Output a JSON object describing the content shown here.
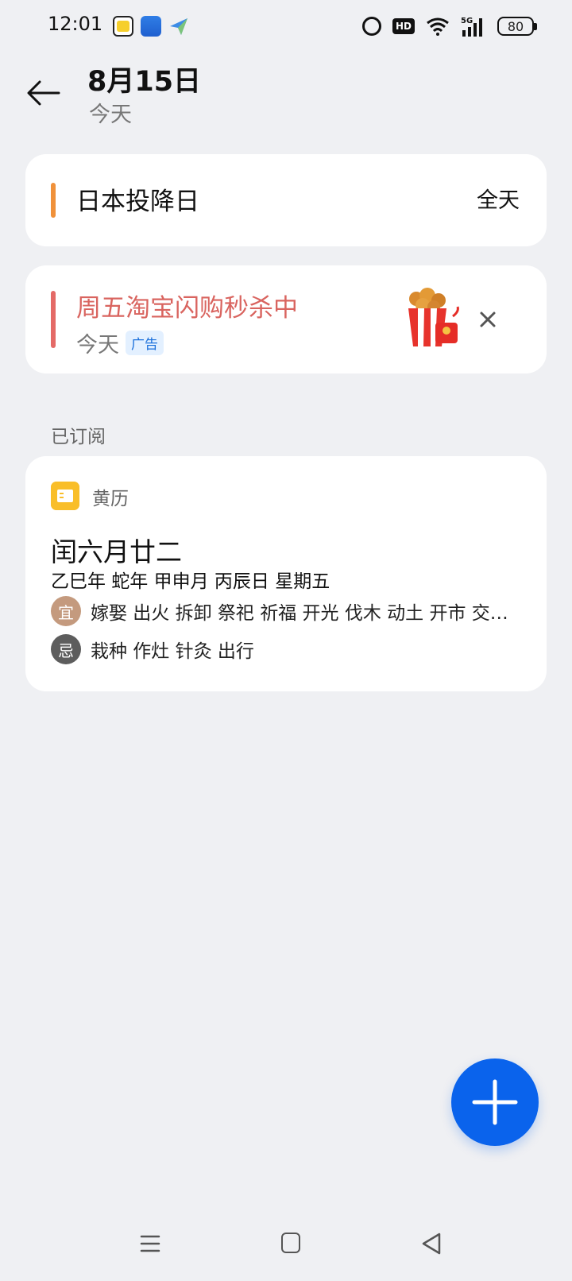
{
  "status_bar": {
    "time": "12:01",
    "battery": "80",
    "hd_label": "HD",
    "icons": [
      "alarm-icon",
      "hd-icon",
      "wifi-icon",
      "5g-signal-icon",
      "battery-icon"
    ]
  },
  "header": {
    "date": "8月15日",
    "subtitle": "今天"
  },
  "event": {
    "title": "日本投降日",
    "time_label": "全天",
    "color": "#f0913a"
  },
  "ad": {
    "title": "周五淘宝闪购秒杀中",
    "subtitle": "今天",
    "badge": "广告",
    "color": "#e46a67"
  },
  "subscribed": {
    "section_label": "已订阅",
    "calendar_name": "黄历",
    "lunar_date": "闰六月廿二",
    "ganzhi": "乙巳年 蛇年 甲申月 丙辰日 星期五",
    "yi_label": "宜",
    "yi_items": "嫁娶 出火 拆卸 祭祀 祈福 开光 伐木 动土 开市 交…",
    "ji_label": "忌",
    "ji_items": "栽种 作灶 针灸 出行"
  },
  "colors": {
    "accent": "#0a63ec",
    "background": "#eff0f3"
  }
}
